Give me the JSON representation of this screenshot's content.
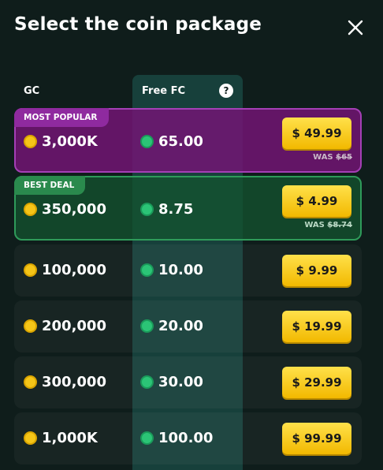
{
  "header": {
    "title": "Select the coin package",
    "close_icon": "close-icon"
  },
  "columns": {
    "gc": "GC",
    "fc": "Free FC",
    "help": "?"
  },
  "packages": [
    {
      "badge": "MOST POPULAR",
      "gc": "3,000K",
      "fc": "65.00",
      "price": "$ 49.99",
      "was_label": "WAS",
      "was_price": "$65"
    },
    {
      "badge": "BEST DEAL",
      "gc": "350,000",
      "fc": "8.75",
      "price": "$ 4.99",
      "was_label": "WAS",
      "was_price": "$8.74"
    },
    {
      "gc": "100,000",
      "fc": "10.00",
      "price": "$ 9.99"
    },
    {
      "gc": "200,000",
      "fc": "20.00",
      "price": "$ 19.99"
    },
    {
      "gc": "300,000",
      "fc": "30.00",
      "price": "$ 29.99"
    },
    {
      "gc": "1,000K",
      "fc": "100.00",
      "price": "$ 99.99"
    }
  ],
  "colors": {
    "accent": "#f5c518",
    "popular": "#8f2a9f",
    "deal": "#2a8a4d",
    "background": "#0f1d1b"
  }
}
